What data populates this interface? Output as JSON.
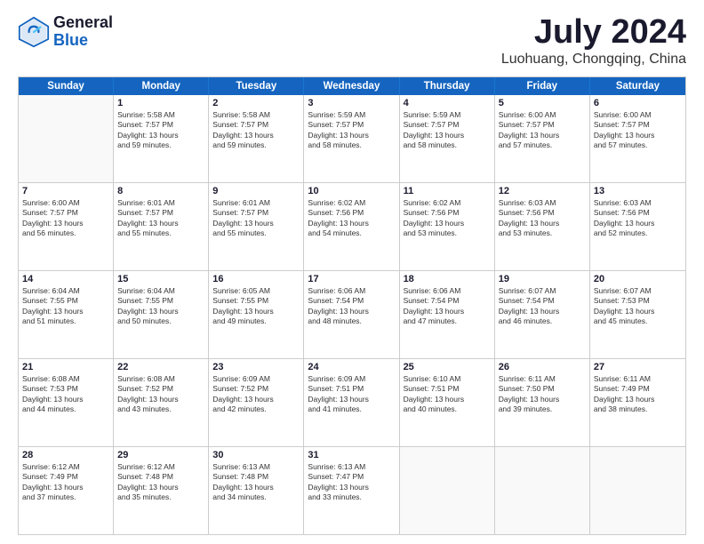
{
  "header": {
    "logo_general": "General",
    "logo_blue": "Blue",
    "month_title": "July 2024",
    "location": "Luohuang, Chongqing, China"
  },
  "calendar": {
    "days_of_week": [
      "Sunday",
      "Monday",
      "Tuesday",
      "Wednesday",
      "Thursday",
      "Friday",
      "Saturday"
    ],
    "rows": [
      [
        {
          "day": "",
          "info": ""
        },
        {
          "day": "1",
          "info": "Sunrise: 5:58 AM\nSunset: 7:57 PM\nDaylight: 13 hours\nand 59 minutes."
        },
        {
          "day": "2",
          "info": "Sunrise: 5:58 AM\nSunset: 7:57 PM\nDaylight: 13 hours\nand 59 minutes."
        },
        {
          "day": "3",
          "info": "Sunrise: 5:59 AM\nSunset: 7:57 PM\nDaylight: 13 hours\nand 58 minutes."
        },
        {
          "day": "4",
          "info": "Sunrise: 5:59 AM\nSunset: 7:57 PM\nDaylight: 13 hours\nand 58 minutes."
        },
        {
          "day": "5",
          "info": "Sunrise: 6:00 AM\nSunset: 7:57 PM\nDaylight: 13 hours\nand 57 minutes."
        },
        {
          "day": "6",
          "info": "Sunrise: 6:00 AM\nSunset: 7:57 PM\nDaylight: 13 hours\nand 57 minutes."
        }
      ],
      [
        {
          "day": "7",
          "info": "Sunrise: 6:00 AM\nSunset: 7:57 PM\nDaylight: 13 hours\nand 56 minutes."
        },
        {
          "day": "8",
          "info": "Sunrise: 6:01 AM\nSunset: 7:57 PM\nDaylight: 13 hours\nand 55 minutes."
        },
        {
          "day": "9",
          "info": "Sunrise: 6:01 AM\nSunset: 7:57 PM\nDaylight: 13 hours\nand 55 minutes."
        },
        {
          "day": "10",
          "info": "Sunrise: 6:02 AM\nSunset: 7:56 PM\nDaylight: 13 hours\nand 54 minutes."
        },
        {
          "day": "11",
          "info": "Sunrise: 6:02 AM\nSunset: 7:56 PM\nDaylight: 13 hours\nand 53 minutes."
        },
        {
          "day": "12",
          "info": "Sunrise: 6:03 AM\nSunset: 7:56 PM\nDaylight: 13 hours\nand 53 minutes."
        },
        {
          "day": "13",
          "info": "Sunrise: 6:03 AM\nSunset: 7:56 PM\nDaylight: 13 hours\nand 52 minutes."
        }
      ],
      [
        {
          "day": "14",
          "info": "Sunrise: 6:04 AM\nSunset: 7:55 PM\nDaylight: 13 hours\nand 51 minutes."
        },
        {
          "day": "15",
          "info": "Sunrise: 6:04 AM\nSunset: 7:55 PM\nDaylight: 13 hours\nand 50 minutes."
        },
        {
          "day": "16",
          "info": "Sunrise: 6:05 AM\nSunset: 7:55 PM\nDaylight: 13 hours\nand 49 minutes."
        },
        {
          "day": "17",
          "info": "Sunrise: 6:06 AM\nSunset: 7:54 PM\nDaylight: 13 hours\nand 48 minutes."
        },
        {
          "day": "18",
          "info": "Sunrise: 6:06 AM\nSunset: 7:54 PM\nDaylight: 13 hours\nand 47 minutes."
        },
        {
          "day": "19",
          "info": "Sunrise: 6:07 AM\nSunset: 7:54 PM\nDaylight: 13 hours\nand 46 minutes."
        },
        {
          "day": "20",
          "info": "Sunrise: 6:07 AM\nSunset: 7:53 PM\nDaylight: 13 hours\nand 45 minutes."
        }
      ],
      [
        {
          "day": "21",
          "info": "Sunrise: 6:08 AM\nSunset: 7:53 PM\nDaylight: 13 hours\nand 44 minutes."
        },
        {
          "day": "22",
          "info": "Sunrise: 6:08 AM\nSunset: 7:52 PM\nDaylight: 13 hours\nand 43 minutes."
        },
        {
          "day": "23",
          "info": "Sunrise: 6:09 AM\nSunset: 7:52 PM\nDaylight: 13 hours\nand 42 minutes."
        },
        {
          "day": "24",
          "info": "Sunrise: 6:09 AM\nSunset: 7:51 PM\nDaylight: 13 hours\nand 41 minutes."
        },
        {
          "day": "25",
          "info": "Sunrise: 6:10 AM\nSunset: 7:51 PM\nDaylight: 13 hours\nand 40 minutes."
        },
        {
          "day": "26",
          "info": "Sunrise: 6:11 AM\nSunset: 7:50 PM\nDaylight: 13 hours\nand 39 minutes."
        },
        {
          "day": "27",
          "info": "Sunrise: 6:11 AM\nSunset: 7:49 PM\nDaylight: 13 hours\nand 38 minutes."
        }
      ],
      [
        {
          "day": "28",
          "info": "Sunrise: 6:12 AM\nSunset: 7:49 PM\nDaylight: 13 hours\nand 37 minutes."
        },
        {
          "day": "29",
          "info": "Sunrise: 6:12 AM\nSunset: 7:48 PM\nDaylight: 13 hours\nand 35 minutes."
        },
        {
          "day": "30",
          "info": "Sunrise: 6:13 AM\nSunset: 7:48 PM\nDaylight: 13 hours\nand 34 minutes."
        },
        {
          "day": "31",
          "info": "Sunrise: 6:13 AM\nSunset: 7:47 PM\nDaylight: 13 hours\nand 33 minutes."
        },
        {
          "day": "",
          "info": ""
        },
        {
          "day": "",
          "info": ""
        },
        {
          "day": "",
          "info": ""
        }
      ]
    ]
  }
}
